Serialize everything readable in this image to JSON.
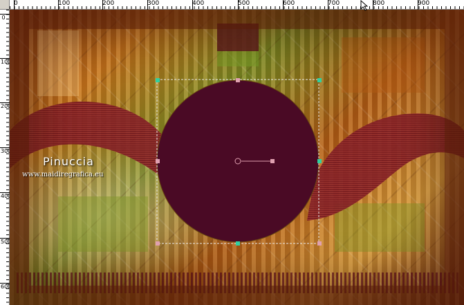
{
  "ruler": {
    "top_labels": [
      "0",
      "100",
      "200",
      "300",
      "400",
      "500",
      "600",
      "700",
      "800",
      "900"
    ],
    "left_labels": [
      "0",
      "100",
      "200",
      "300",
      "400",
      "500",
      "600"
    ]
  },
  "watermark": {
    "name": "Pinuccia",
    "url": "www.maidiregrafica.eu"
  },
  "shape": {
    "type": "circle",
    "fill": "#4a0a25",
    "handle_color": "#e0a0b0",
    "corner_handle_color": "#30d0a0"
  },
  "colors": {
    "ruler_bg": "#ffffff",
    "app_bg": "#d4d0c8"
  }
}
